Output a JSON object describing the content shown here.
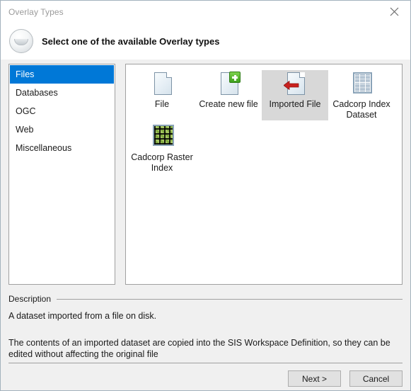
{
  "window": {
    "title": "Overlay Types",
    "close_icon": "close-icon"
  },
  "header": {
    "icon": "overlay-sphere-icon",
    "title": "Select one of the available Overlay types"
  },
  "categories": [
    {
      "label": "Files",
      "selected": true
    },
    {
      "label": "Databases",
      "selected": false
    },
    {
      "label": "OGC",
      "selected": false
    },
    {
      "label": "Web",
      "selected": false
    },
    {
      "label": "Miscellaneous",
      "selected": false
    }
  ],
  "overlay_types": [
    {
      "label": "File",
      "icon": "document-icon",
      "selected": false
    },
    {
      "label": "Create new file",
      "icon": "document-add-icon",
      "selected": false
    },
    {
      "label": "Imported File",
      "icon": "document-import-icon",
      "selected": true
    },
    {
      "label": "Cadcorp Index Dataset",
      "icon": "table-grid-icon",
      "selected": false
    },
    {
      "label": "Cadcorp Raster Index",
      "icon": "raster-grid-icon",
      "selected": false
    }
  ],
  "description": {
    "title": "Description",
    "paragraph1": "A dataset imported from a file on disk.",
    "paragraph2": "The contents of an imported dataset are copied into the SIS Workspace Definition, so they can be edited without affecting the original file"
  },
  "footer": {
    "next_label": "Next >",
    "cancel_label": "Cancel"
  },
  "colors": {
    "selection_blue": "#0078d7",
    "selection_gray": "#d8d8d8",
    "dialog_bg": "#f0f0f0"
  }
}
